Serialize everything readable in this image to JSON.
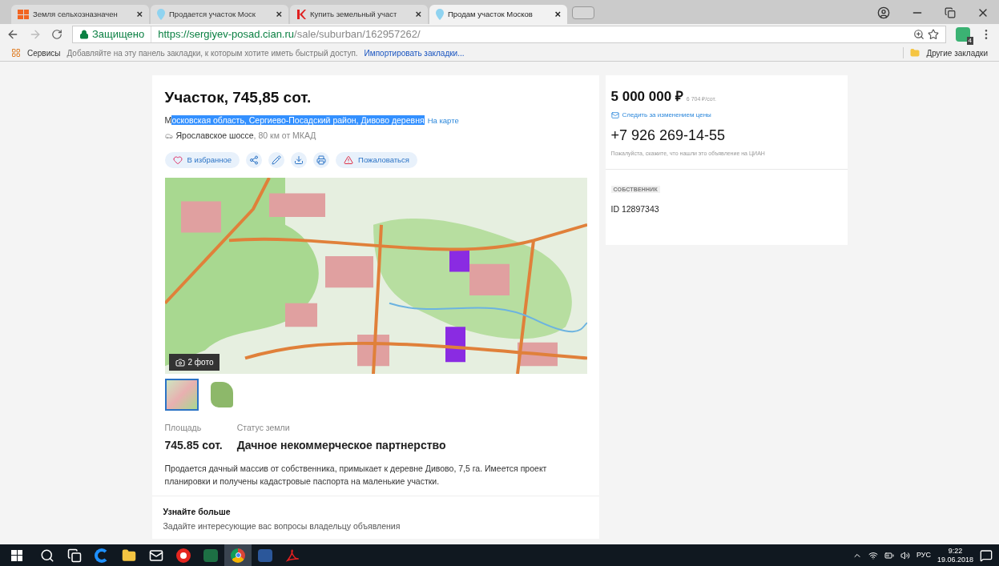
{
  "browser": {
    "tabs": [
      {
        "title": "Земля сельхозназначен",
        "selected": false
      },
      {
        "title": "Продается участок Моск",
        "selected": false
      },
      {
        "title": "Купить земельный участ",
        "selected": false
      },
      {
        "title": "Продам участок Москов",
        "selected": true
      }
    ],
    "close_glyph": "×",
    "secure_label": "Защищено",
    "url_host": "https://sergiyev-posad.cian.ru",
    "url_path": "/sale/suburban/162957262/",
    "extension_badge": "4",
    "bookmarks": {
      "apps": "Сервисы",
      "hint": "Добавляйте на эту панель закладки, к которым хотите иметь быстрый доступ.",
      "import_link": "Импортировать закладки...",
      "other": "Другие закладки"
    }
  },
  "listing": {
    "title": "Участок, 745,85 сот.",
    "address_parts": [
      {
        "text": "М",
        "highlighted": false
      },
      {
        "text": "осковская область, Сергиево-Посадский район, Дивово деревня",
        "highlighted": true
      }
    ],
    "map_link": "На карте",
    "highway": "Ярославское шоссе",
    "distance": ", 80 км от МКАД",
    "actions": [
      {
        "kind": "text",
        "label": "В избранное"
      },
      {
        "kind": "icon"
      },
      {
        "kind": "icon"
      },
      {
        "kind": "icon"
      },
      {
        "kind": "icon"
      },
      {
        "kind": "text",
        "label": "Пожаловаться"
      }
    ],
    "photo_count": "2 фото",
    "thumbnails": [
      {
        "kind": "map",
        "selected": true
      },
      {
        "kind": "plot",
        "selected": false
      }
    ],
    "facts": [
      {
        "label": "Площадь",
        "value": "745.85 сот."
      },
      {
        "label": "Статус земли",
        "value": "Дачное некоммерческое партнерство"
      }
    ],
    "description": "Продается дачный массив от собственника, примыкает к деревне Дивово, 7,5 га. Имеется проект планировки и получены кадастровые паспорта на маленькие участки.",
    "more_title": "Узнайте больше",
    "more_text": "Задайте интересующие вас вопросы владельцу объявления"
  },
  "sidebar": {
    "price": "5 000 000 ₽",
    "price_per": "6 704 ₽/сот.",
    "watch_link": "Следить за изменением цены",
    "phone": "+7 926 269-14-55",
    "phone_note": "Пожалуйста, скажите, что нашли это объявление на ЦИАН",
    "owner_badge": "СОБСТВЕННИК",
    "owner_id": "ID 12897343"
  },
  "taskbar": {
    "apps": [
      {
        "selected": false
      },
      {
        "selected": false
      },
      {
        "selected": false
      },
      {
        "selected": false
      },
      {
        "selected": false
      },
      {
        "selected": false
      },
      {
        "selected": false
      },
      {
        "selected": true
      },
      {
        "selected": false
      },
      {
        "selected": false
      }
    ],
    "language": "РУС",
    "time": "9:22",
    "date": "19.06.2018"
  }
}
